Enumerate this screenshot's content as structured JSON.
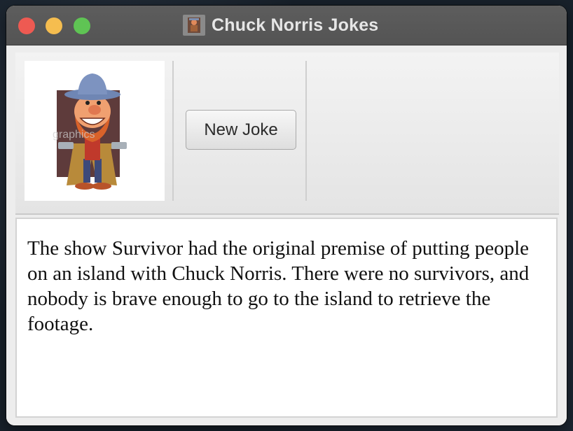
{
  "window": {
    "title": "Chuck Norris Jokes",
    "icon": "chuck-norris-app-icon"
  },
  "toolbar": {
    "image": "chuck-norris-cartoon-image",
    "new_joke_label": "New Joke"
  },
  "joke": {
    "text": "The show Survivor had the original premise of putting people on an island with Chuck Norris. There were no survivors, and nobody is brave enough to go to the island to retrieve the footage."
  },
  "colors": {
    "titlebar": "#555555",
    "close": "#ee5a52",
    "minimize": "#f5bd4f",
    "maximize": "#5fc454"
  }
}
